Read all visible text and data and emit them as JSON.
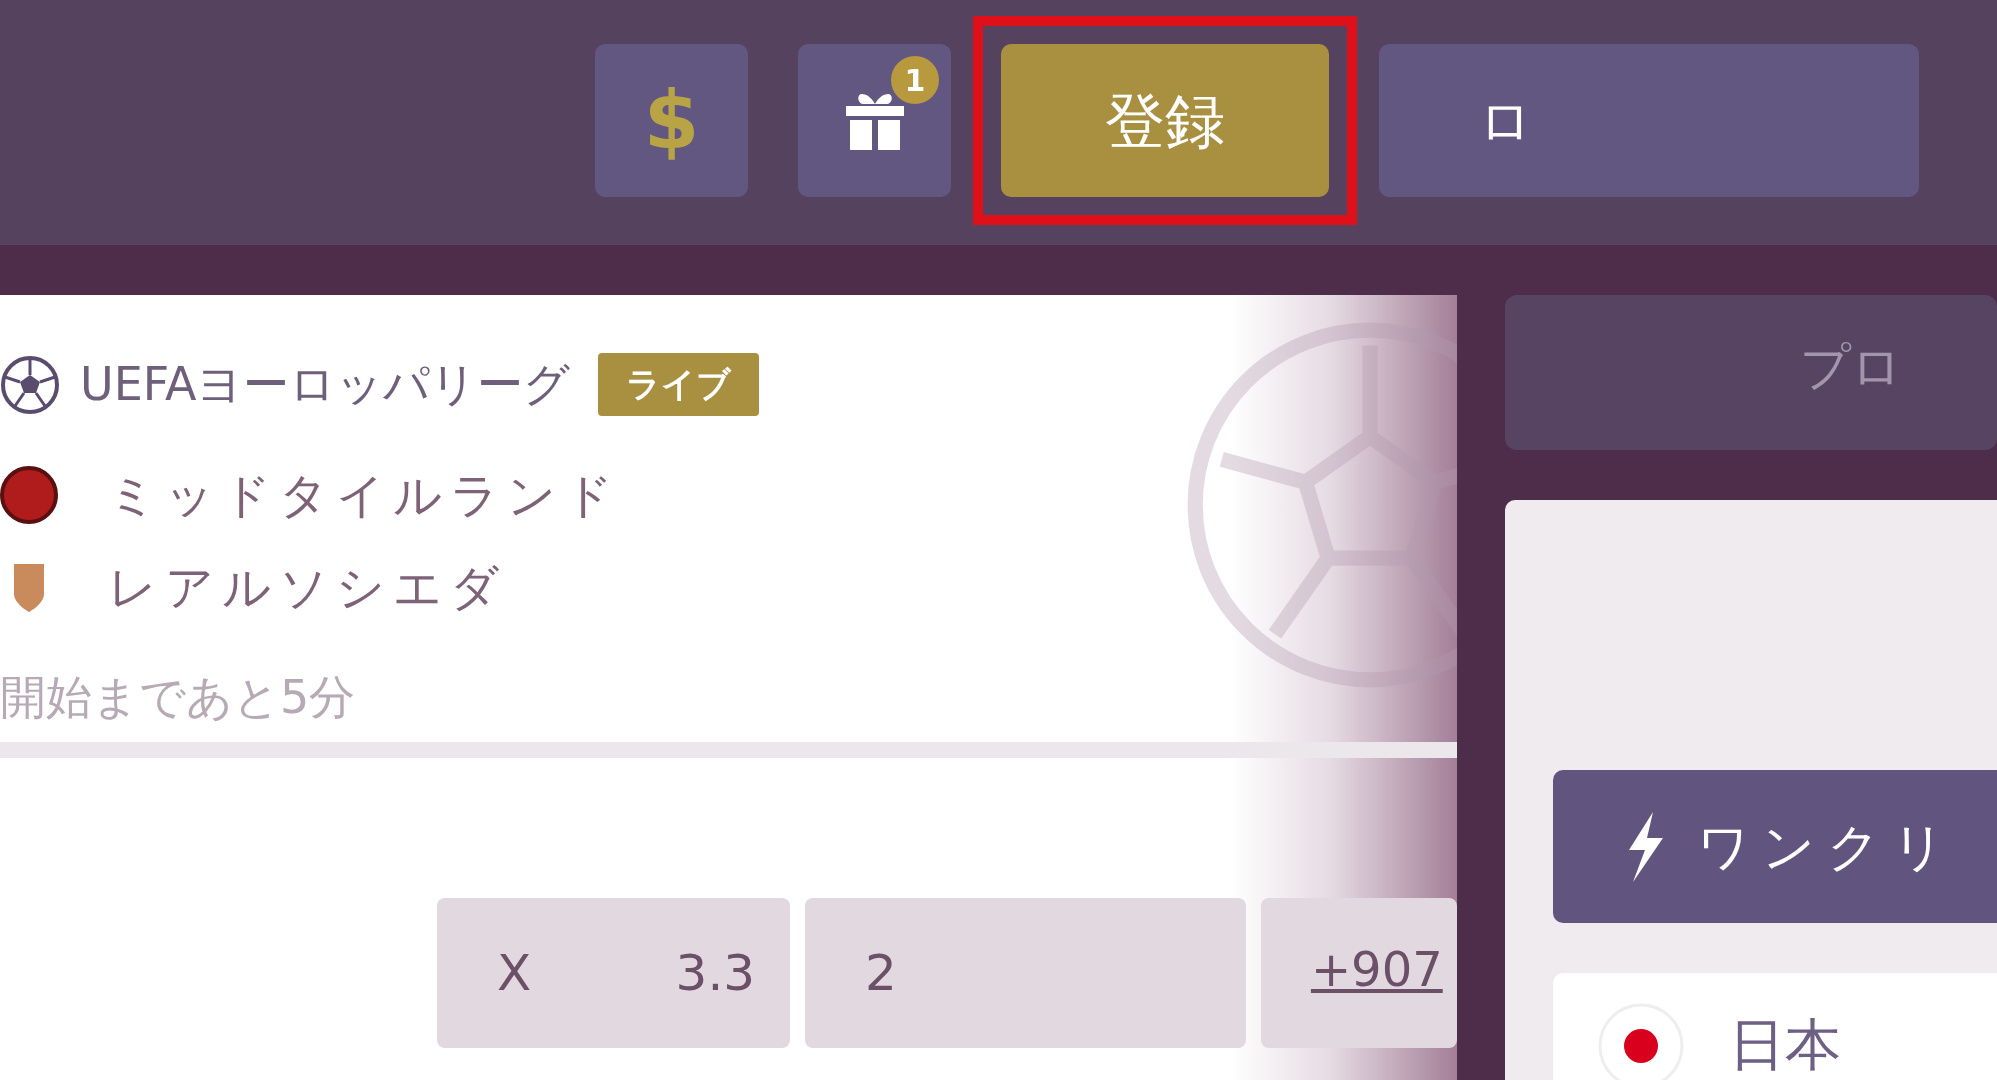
{
  "header": {
    "buttons": [
      {
        "kind": "currency",
        "label": "$",
        "highlighted": false
      },
      {
        "kind": "gift",
        "badge": "1",
        "highlighted": false
      },
      {
        "kind": "register",
        "label": "登録",
        "highlighted": true
      },
      {
        "kind": "login",
        "label": "ロ",
        "highlighted": false
      }
    ]
  },
  "match": {
    "league": "UEFAヨーロッパリーグ",
    "live_badge": "ライブ",
    "teams": [
      {
        "name": "ミッドタイルランド"
      },
      {
        "name": "レアルソシエダ"
      }
    ],
    "countdown": "開始まであと5分",
    "odds": [
      {
        "label": "X",
        "value": "3.3"
      },
      {
        "label": "2"
      }
    ],
    "more_markets": "+907"
  },
  "sidebar": {
    "promo_label": "プロ",
    "one_click_button": "ワンクリ",
    "country": "日本"
  }
}
